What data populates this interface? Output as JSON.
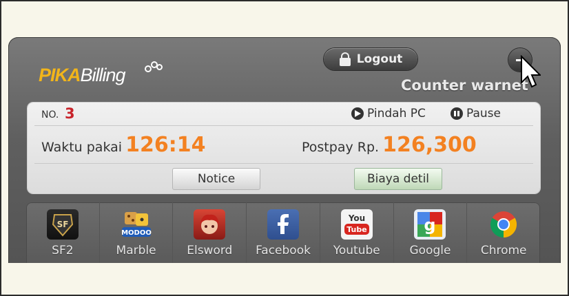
{
  "header": {
    "logo_pika": "PIKA",
    "logo_billing": "Billing",
    "logout_label": "Logout",
    "counter_name": "Counter warnet"
  },
  "session": {
    "no_label": "NO.",
    "no_value": "3",
    "pindah_pc_label": "Pindah PC",
    "pause_label": "Pause",
    "waktu_label": "Waktu pakai",
    "waktu_value": "126:14",
    "postpay_label": "Postpay Rp.",
    "postpay_value": "126,300"
  },
  "buttons": {
    "notice_label": "Notice",
    "biaya_label": "Biaya detil"
  },
  "apps": [
    {
      "label": "SF2",
      "icon": "sf2-icon"
    },
    {
      "label": "Marble",
      "icon": "modoo-marble-icon"
    },
    {
      "label": "Elsword",
      "icon": "elsword-icon"
    },
    {
      "label": "Facebook",
      "icon": "facebook-icon"
    },
    {
      "label": "Youtube",
      "icon": "youtube-icon"
    },
    {
      "label": "Google",
      "icon": "google-icon"
    },
    {
      "label": "Chrome",
      "icon": "chrome-icon"
    }
  ],
  "colors": {
    "accent_orange": "#f38121",
    "number_red": "#c8232a",
    "logo_yellow": "#f2b51a"
  }
}
